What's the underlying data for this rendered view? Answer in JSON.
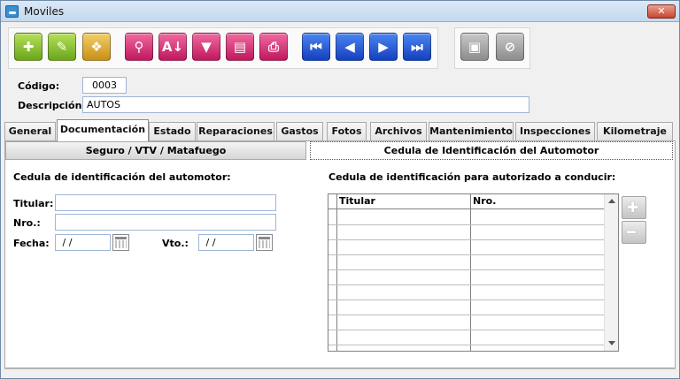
{
  "window": {
    "title": "Moviles",
    "close_label": "✕"
  },
  "toolbar": [
    {
      "name": "add-button",
      "icon": "plus-icon",
      "glyph": "✚"
    },
    {
      "name": "edit-button",
      "icon": "pencil-icon",
      "glyph": "✎"
    },
    {
      "name": "copy-button",
      "icon": "document-star-icon",
      "glyph": "❖"
    },
    {
      "name": "search-button",
      "icon": "magnifier-icon",
      "glyph": "⚲"
    },
    {
      "name": "sort-button",
      "icon": "sort-az-icon",
      "glyph": "A↓"
    },
    {
      "name": "filter-button",
      "icon": "funnel-icon",
      "glyph": "▼"
    },
    {
      "name": "report-button",
      "icon": "clipboard-icon",
      "glyph": "▤"
    },
    {
      "name": "print-button",
      "icon": "printer-icon",
      "glyph": "⎙"
    },
    {
      "name": "first-record-button",
      "icon": "first-icon",
      "glyph": "⏮"
    },
    {
      "name": "previous-record-button",
      "icon": "previous-icon",
      "glyph": "◀"
    },
    {
      "name": "next-record-button",
      "icon": "next-icon",
      "glyph": "▶"
    },
    {
      "name": "last-record-button",
      "icon": "last-icon",
      "glyph": "⏭"
    },
    {
      "name": "save-button",
      "icon": "floppy-icon",
      "glyph": "▣"
    },
    {
      "name": "cancel-button",
      "icon": "cancel-icon",
      "glyph": "⊘"
    }
  ],
  "form": {
    "codigo_label": "Código:",
    "codigo_value": "0003",
    "descripcion_label": "Descripción:",
    "descripcion_value": "AUTOS"
  },
  "tabs": [
    {
      "label": "General"
    },
    {
      "label": "Documentación"
    },
    {
      "label": "Estado"
    },
    {
      "label": "Reparaciones"
    },
    {
      "label": "Gastos"
    },
    {
      "label": "Fotos"
    },
    {
      "label": "Archivos"
    },
    {
      "label": "Mantenimiento"
    },
    {
      "label": "Inspecciones"
    },
    {
      "label": "Kilometraje"
    }
  ],
  "active_tab": "Documentación",
  "subtabs": [
    {
      "label": "Seguro / VTV / Matafuego"
    },
    {
      "label": "Cedula de Identificación del Automotor"
    }
  ],
  "cedula": {
    "section_title": "Cedula de identificación del automotor:",
    "titular_label": "Titular:",
    "titular_value": "",
    "nro_label": "Nro.:",
    "nro_value": "",
    "fecha_label": "Fecha:",
    "fecha_value": " / /",
    "vto_label": "Vto.:",
    "vto_value": " / /"
  },
  "autorizado": {
    "section_title": "Cedula de identificación para autorizado a conducir:",
    "columns": [
      "Titular",
      "Nro."
    ],
    "rows": [
      [
        "",
        ""
      ],
      [
        "",
        ""
      ],
      [
        "",
        ""
      ],
      [
        "",
        ""
      ],
      [
        "",
        ""
      ],
      [
        "",
        ""
      ],
      [
        "",
        ""
      ],
      [
        "",
        ""
      ],
      [
        "",
        ""
      ]
    ],
    "add_glyph": "✚",
    "remove_glyph": "━"
  },
  "colors": {
    "green": "#6aa51c",
    "gold": "#c98f14",
    "pink": "#c1175e",
    "blue": "#163fc0",
    "gray": "#8c8c8c",
    "close": "#c8452e"
  }
}
